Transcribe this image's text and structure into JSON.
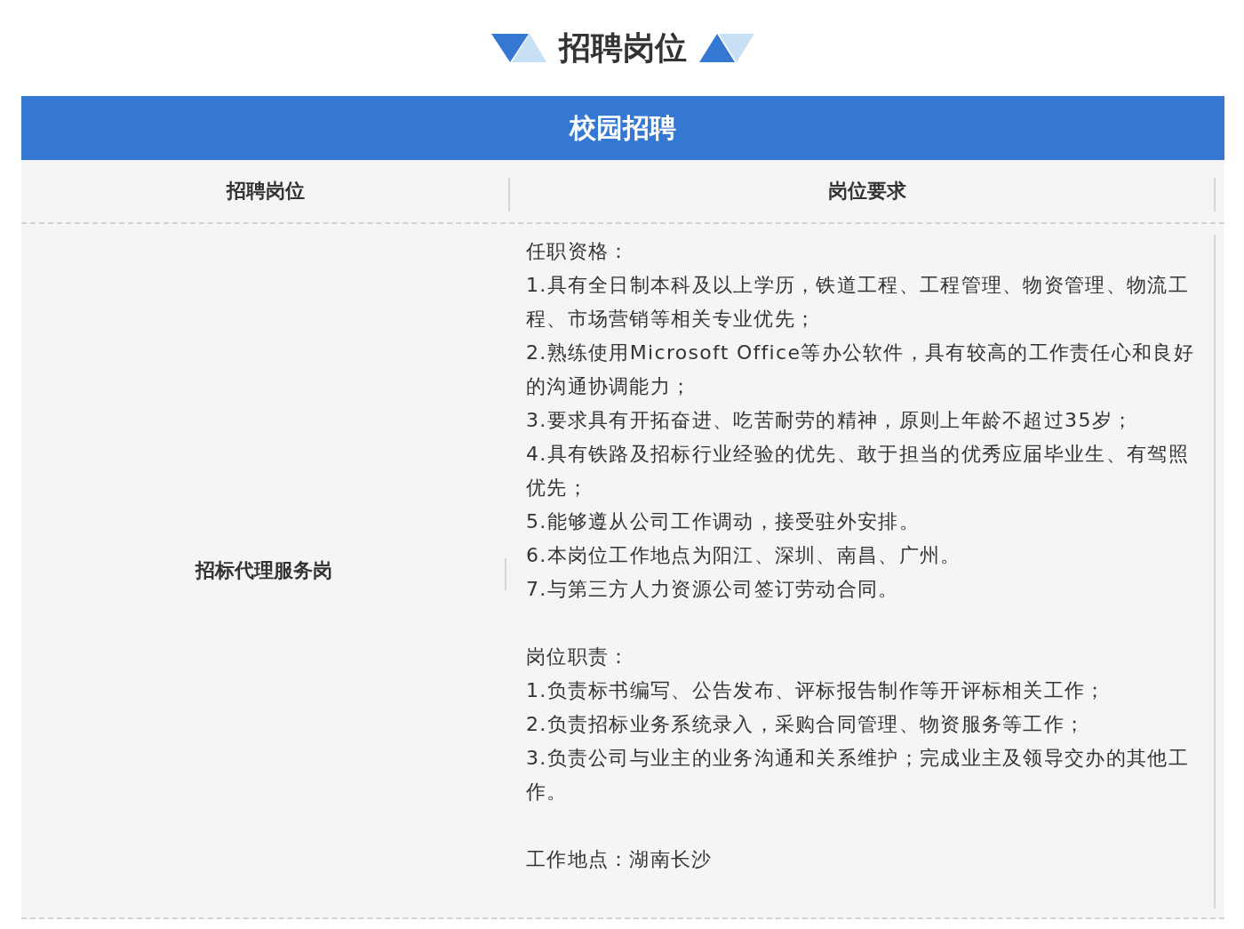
{
  "title": "招聘岗位",
  "banner": "校园招聘",
  "table": {
    "columns": [
      "招聘岗位",
      "岗位要求"
    ],
    "rows": [
      {
        "position": "招标代理服务岗",
        "sections": [
          {
            "heading": "任职资格：",
            "items": [
              "1.具有全日制本科及以上学历，铁道工程、工程管理、物资管理、物流工程、市场营销等相关专业优先；",
              "2.熟练使用Microsoft Office等办公软件，具有较高的工作责任心和良好的沟通协调能力；",
              "3.要求具有开拓奋进、吃苦耐劳的精神，原则上年龄不超过35岁；",
              "4.具有铁路及招标行业经验的优先、敢于担当的优秀应届毕业生、有驾照优先；",
              "5.能够遵从公司工作调动，接受驻外安排。",
              "6.本岗位工作地点为阳江、深圳、南昌、广州。",
              "7.与第三方人力资源公司签订劳动合同。"
            ]
          },
          {
            "heading": "岗位职责：",
            "items": [
              "1.负责标书编写、公告发布、评标报告制作等开评标相关工作；",
              "2.负责招标业务系统录入，采购合同管理、物资服务等工作；",
              "3.负责公司与业主的业务沟通和关系维护；完成业主及领导交办的其他工作。"
            ]
          },
          {
            "heading": "工作地点：湖南长沙"
          }
        ]
      }
    ]
  }
}
